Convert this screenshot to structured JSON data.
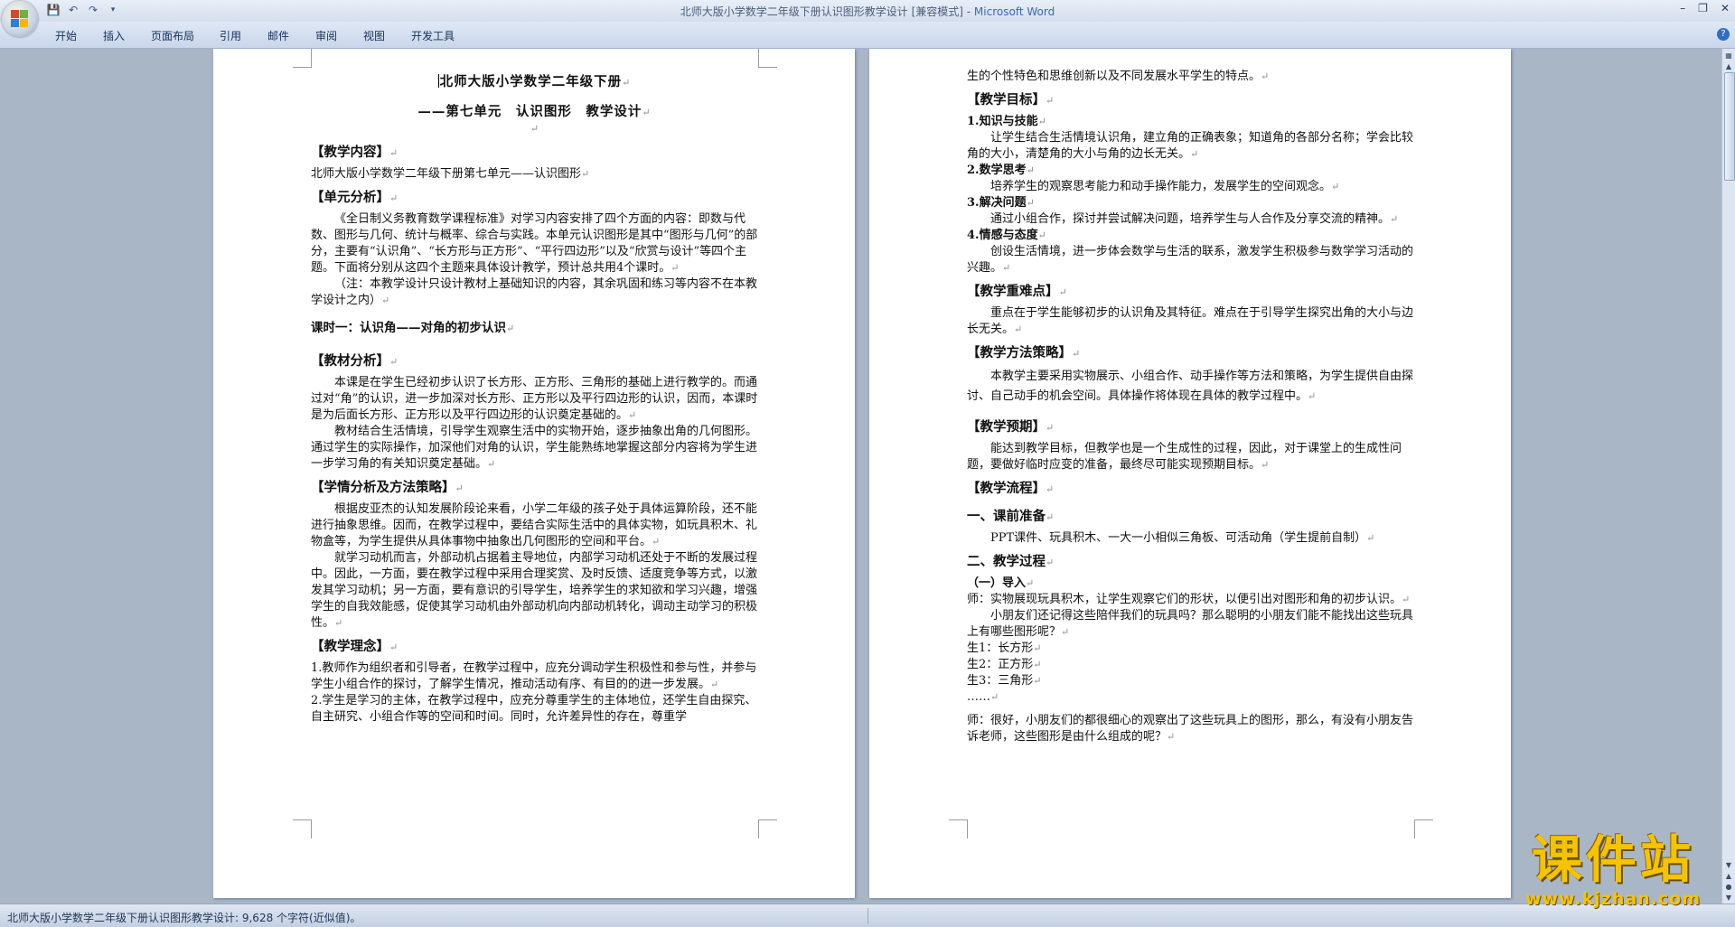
{
  "window": {
    "title": "北师大版小学数学二年级下册认识图形教学设计 [兼容模式] - ",
    "app_name": "Microsoft Word"
  },
  "ribbon": {
    "tabs": [
      "开始",
      "插入",
      "页面布局",
      "引用",
      "邮件",
      "审阅",
      "视图",
      "开发工具"
    ]
  },
  "page1": {
    "title": "北师大版小学数学二年级下册",
    "subtitle": "——第七单元　认识图形　教学设计",
    "h_content": "【教学内容】",
    "content_text": "北师大版小学数学二年级下册第七单元——认识图形",
    "h_unit": "【单元分析】",
    "unit_p1": "《全日制义务教育数学课程标准》对学习内容安排了四个方面的内容：即数与代数、图形与几何、统计与概率、综合与实践。本单元认识图形是其中“图形与几何”的部分，主要有“认识角”、“长方形与正方形”、“平行四边形”以及“欣赏与设计”等四个主题。下面将分别从这四个主题来具体设计教学，预计总共用4个课时。",
    "unit_p2": "（注：本教学设计只设计教材上基础知识的内容，其余巩固和练习等内容不在本教学设计之内）",
    "lesson": "课时一：认识角——对角的初步认识",
    "h_material": "【教材分析】",
    "material_p1": "本课是在学生已经初步认识了长方形、正方形、三角形的基础上进行教学的。而通过对“角”的认识，进一步加深对长方形、正方形以及平行四边形的认识，因而，本课时是为后面长方形、正方形以及平行四边形的认识奠定基础的。",
    "material_p2": "教材结合生活情境，引导学生观察生活中的实物开始，逐步抽象出角的几何图形。通过学生的实际操作，加深他们对角的认识，学生能熟练地掌握这部分内容将为学生进一步学习角的有关知识奠定基础。",
    "h_learner": "【学情分析及方法策略】",
    "learner_p1": "根据皮亚杰的认知发展阶段论来看，小学二年级的孩子处于具体运算阶段，还不能进行抽象思维。因而，在教学过程中，要结合实际生活中的具体实物，如玩具积木、礼物盒等，为学生提供从具体事物中抽象出几何图形的空间和平台。",
    "learner_p2": "就学习动机而言，外部动机占据着主导地位，内部学习动机还处于不断的发展过程中。因此，一方面，要在教学过程中采用合理奖赏、及时反馈、适度竞争等方式，以激发其学习动机；另一方面，要有意识的引导学生，培养学生的求知欲和学习兴趣，增强学生的自我效能感，促使其学习动机由外部动机向内部动机转化，调动主动学习的积极性。",
    "h_idea": "【教学理念】",
    "idea_p1": "1.教师作为组织者和引导者，在教学过程中，应充分调动学生积极性和参与性，并参与学生小组合作的探讨，了解学生情况，推动活动有序、有目的的进一步发展。",
    "idea_p2": "2.学生是学习的主体，在教学过程中，应充分尊重学生的主体地位，还学生自由探究、自主研究、小组合作等的空间和时间。同时，允许差异性的存在，尊重学"
  },
  "page2": {
    "cont": "生的个性特色和思维创新以及不同发展水平学生的特点。",
    "h_goal": "【教学目标】",
    "g1_t": "1.知识与技能",
    "g1": "让学生结合生活情境认识角，建立角的正确表象；知道角的各部分名称；学会比较角的大小，清楚角的大小与角的边长无关。",
    "g2_t": "2.数学思考",
    "g2": "培养学生的观察思考能力和动手操作能力，发展学生的空间观念。",
    "g3_t": "3.解决问题",
    "g3": "通过小组合作，探讨并尝试解决问题，培养学生与人合作及分享交流的精神。",
    "g4_t": "4.情感与态度",
    "g4": "创设生活情境，进一步体会数学与生活的联系，激发学生积极参与数学学习活动的兴趣。",
    "h_key": "【教学重难点】",
    "key": "重点在于学生能够初步的认识角及其特征。难点在于引导学生探究出角的大小与边长无关。",
    "h_method": "【教学方法策略】",
    "method": "本教学主要采用实物展示、小组合作、动手操作等方法和策略，为学生提供自由探讨、自己动手的机会空间。具体操作将体现在具体的教学过程中。",
    "h_expect": "【教学预期】",
    "expect": "能达到教学目标，但教学也是一个生成性的过程，因此，对于课堂上的生成性问题，要做好临时应变的准备，最终尽可能实现预期目标。",
    "h_flow": "【教学流程】",
    "s1": "一、课前准备",
    "s1_text": "PPT课件、玩具积木、一大一小相似三角板、可活动角（学生提前自制）",
    "s2": "二、教学过程",
    "s2_1": "（一）导入",
    "t1": "师：实物展现玩具积木，让学生观察它们的形状，以便引出对图形和角的初步认识。",
    "t2": "小朋友们还记得这些陪伴我们的玩具吗？那么聪明的小朋友们能不能找出这些玩具上有哪些图形呢？",
    "a1": "生1：长方形",
    "a2": "生2：正方形",
    "a3": "生3：三角形",
    "dots": "……",
    "t3": "师：很好，小朋友们的都很细心的观察出了这些玩具上的图形，那么，有没有小朋友告诉老师，这些图形是由什么组成的呢？"
  },
  "status": {
    "text": "北师大版小学数学二年级下册认识图形教学设计: 9,628 个字符(近似值)。"
  },
  "watermark": {
    "line1": "课件站",
    "line2": "www.kjzhan.com"
  },
  "colors": {
    "logo_red": "#e2432a",
    "logo_green": "#6cb33f",
    "logo_blue": "#2f7ed8",
    "logo_yellow": "#f7b500",
    "watermark": "#f5c400"
  }
}
